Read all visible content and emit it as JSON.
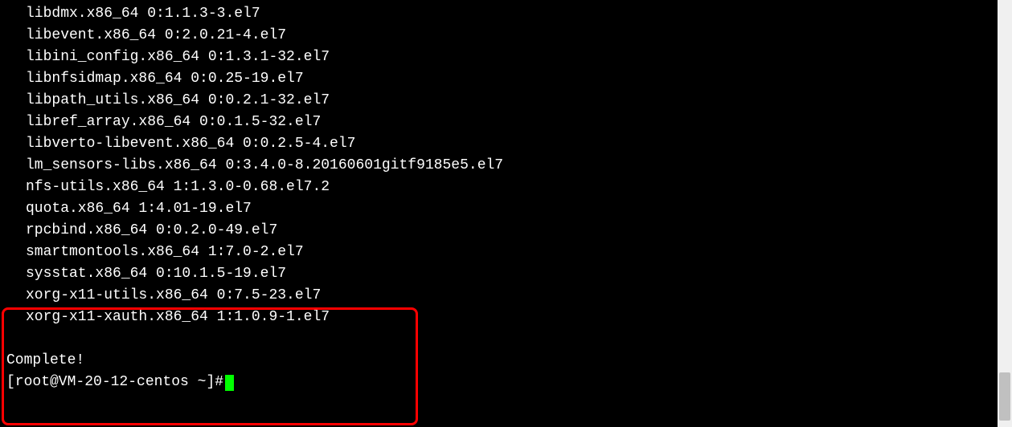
{
  "terminal": {
    "lines": [
      "libdmx.x86_64 0:1.1.3-3.el7",
      "libevent.x86_64 0:2.0.21-4.el7",
      "libini_config.x86_64 0:1.3.1-32.el7",
      "libnfsidmap.x86_64 0:0.25-19.el7",
      "libpath_utils.x86_64 0:0.2.1-32.el7",
      "libref_array.x86_64 0:0.1.5-32.el7",
      "libverto-libevent.x86_64 0:0.2.5-4.el7",
      "lm_sensors-libs.x86_64 0:3.4.0-8.20160601gitf9185e5.el7",
      "nfs-utils.x86_64 1:1.3.0-0.68.el7.2",
      "quota.x86_64 1:4.01-19.el7",
      "rpcbind.x86_64 0:0.2.0-49.el7",
      "smartmontools.x86_64 1:7.0-2.el7",
      "sysstat.x86_64 0:10.1.5-19.el7",
      "xorg-x11-utils.x86_64 0:7.5-23.el7",
      "xorg-x11-xauth.x86_64 1:1.0.9-1.el7"
    ],
    "complete": "Complete!",
    "prompt": "[root@VM-20-12-centos ~]# "
  }
}
